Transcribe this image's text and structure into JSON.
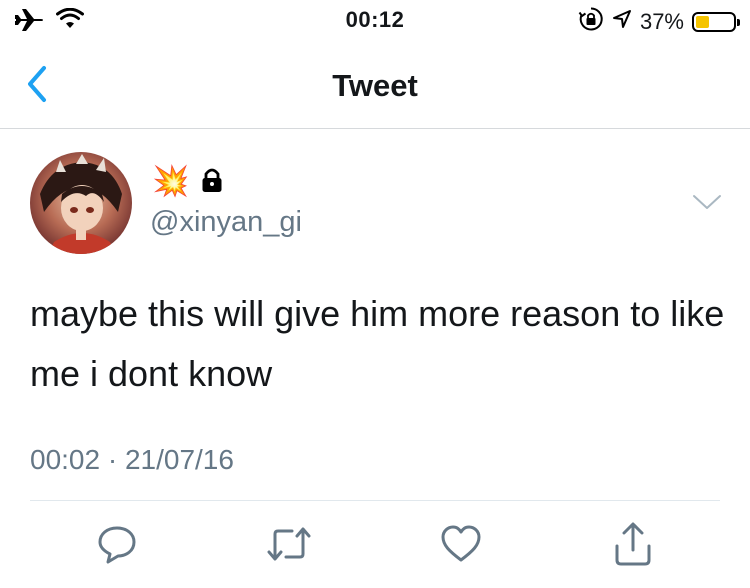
{
  "status_bar": {
    "time": "00:12",
    "battery_percent": "37%",
    "battery_level": 0.37,
    "icons": [
      "airplane-icon",
      "wifi-icon",
      "orientation-lock-icon",
      "location-icon",
      "battery-icon"
    ]
  },
  "nav": {
    "title": "Tweet",
    "back_icon": "chevron-left-icon"
  },
  "tweet": {
    "display_name": "💥",
    "protected_icon": "lock-icon",
    "handle": "@xinyan_gi",
    "text": "maybe this will give him more reason to like me i dont know",
    "timestamp": "00:02 · 21/07/16"
  },
  "actions": [
    "reply-icon",
    "retweet-icon",
    "like-icon",
    "share-icon"
  ],
  "colors": {
    "accent": "#1da1f2",
    "secondary_text": "#657786",
    "battery_fill": "#f5c400"
  }
}
